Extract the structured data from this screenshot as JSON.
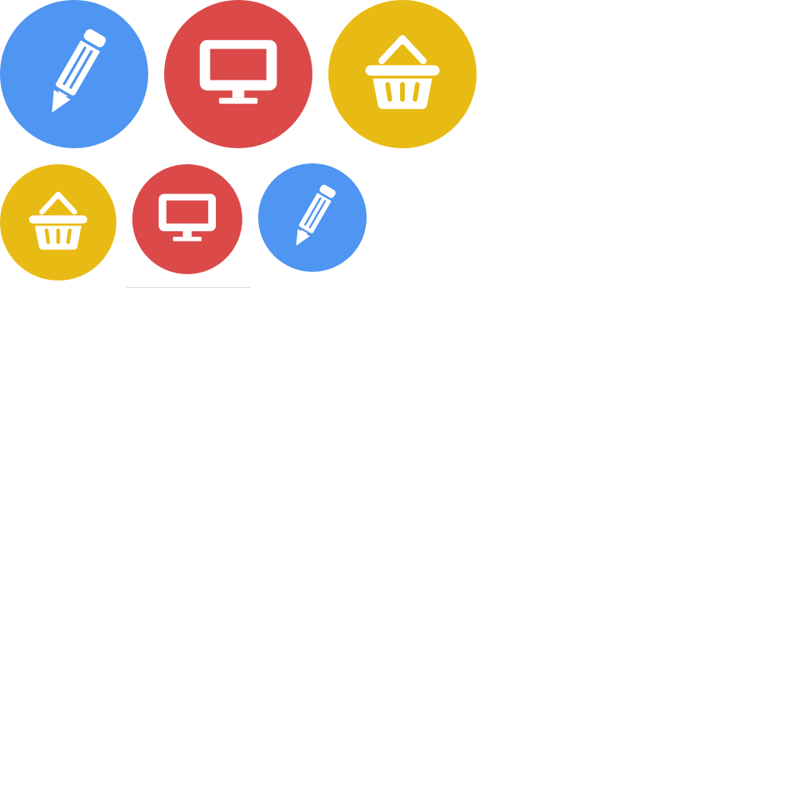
{
  "icon_buttons": [
    {
      "icon": "pencil-icon",
      "color": "#4f95f2"
    },
    {
      "icon": "monitor-icon",
      "color": "#db4949"
    },
    {
      "icon": "basket-icon",
      "color": "#e8bb14"
    },
    {
      "icon": "basket-icon",
      "color": "#e8bb14"
    },
    {
      "icon": "monitor-icon",
      "color": "#db4949"
    },
    {
      "icon": "pencil-icon",
      "color": "#4f95f2"
    }
  ],
  "colors": {
    "blue": "#4f95f2",
    "red": "#db4949",
    "yellow": "#e8bb14",
    "icon_fill": "#ffffff",
    "divider": "#d9d9d9"
  }
}
